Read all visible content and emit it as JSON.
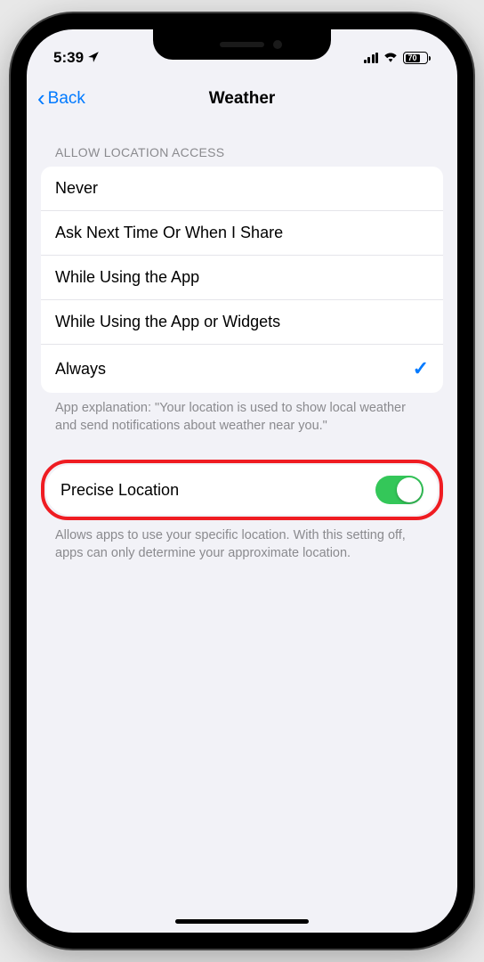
{
  "status_bar": {
    "time": "5:39",
    "battery_percent": "70"
  },
  "nav": {
    "back_label": "Back",
    "title": "Weather"
  },
  "section_header": "Allow Location Access",
  "options": [
    {
      "label": "Never",
      "selected": false
    },
    {
      "label": "Ask Next Time Or When I Share",
      "selected": false
    },
    {
      "label": "While Using the App",
      "selected": false
    },
    {
      "label": "While Using the App or Widgets",
      "selected": false
    },
    {
      "label": "Always",
      "selected": true
    }
  ],
  "explanation": "App explanation: \"Your location is used to show local weather and send notifications about weather near you.\"",
  "precise": {
    "label": "Precise Location",
    "enabled": true
  },
  "precise_footer": "Allows apps to use your specific location. With this setting off, apps can only determine your approximate location."
}
